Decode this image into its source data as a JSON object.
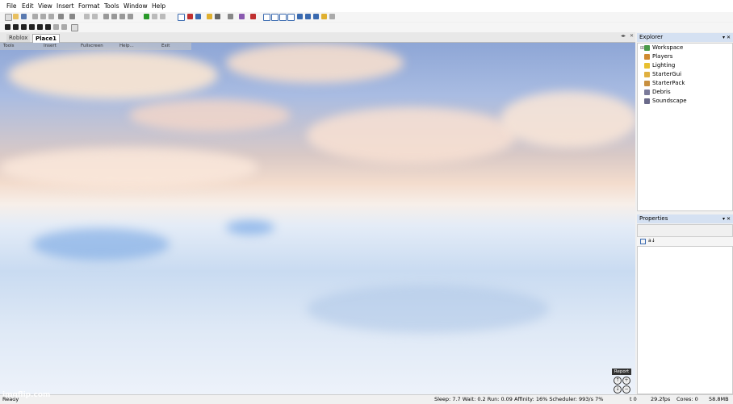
{
  "menu": [
    "File",
    "Edit",
    "View",
    "Insert",
    "Format",
    "Tools",
    "Window",
    "Help"
  ],
  "tabs": {
    "roblox": "Roblox",
    "place": "Place1"
  },
  "ingame_menu": [
    "Tools",
    "Insert",
    "Fullscreen",
    "Help...",
    "Exit"
  ],
  "explorer": {
    "title": "Explorer",
    "items": [
      {
        "label": "Workspace",
        "icon": "workspace-icon",
        "color": "#4a9a4a"
      },
      {
        "label": "Players",
        "icon": "players-icon",
        "color": "#d08a30"
      },
      {
        "label": "Lighting",
        "icon": "lighting-icon",
        "color": "#e8c030"
      },
      {
        "label": "StarterGui",
        "icon": "startergui-icon",
        "color": "#e0b040"
      },
      {
        "label": "StarterPack",
        "icon": "starterpack-icon",
        "color": "#c89040"
      },
      {
        "label": "Debris",
        "icon": "debris-icon",
        "color": "#7a7a9a"
      },
      {
        "label": "Soundscape",
        "icon": "soundscape-icon",
        "color": "#6a6a8a"
      }
    ]
  },
  "properties": {
    "title": "Properties"
  },
  "viewport": {
    "report_label": "Report"
  },
  "status": {
    "left": "Ready",
    "stats": "Sleep: 7.7 Wait: 0.2 Run: 0.09 Affinity: 16% Scheduler: 993/s 7%",
    "t": "t 0",
    "fps": "29.2fps",
    "cores": "Cores: 0",
    "memory": "58.8MB"
  },
  "watermark": "imgflip.com"
}
